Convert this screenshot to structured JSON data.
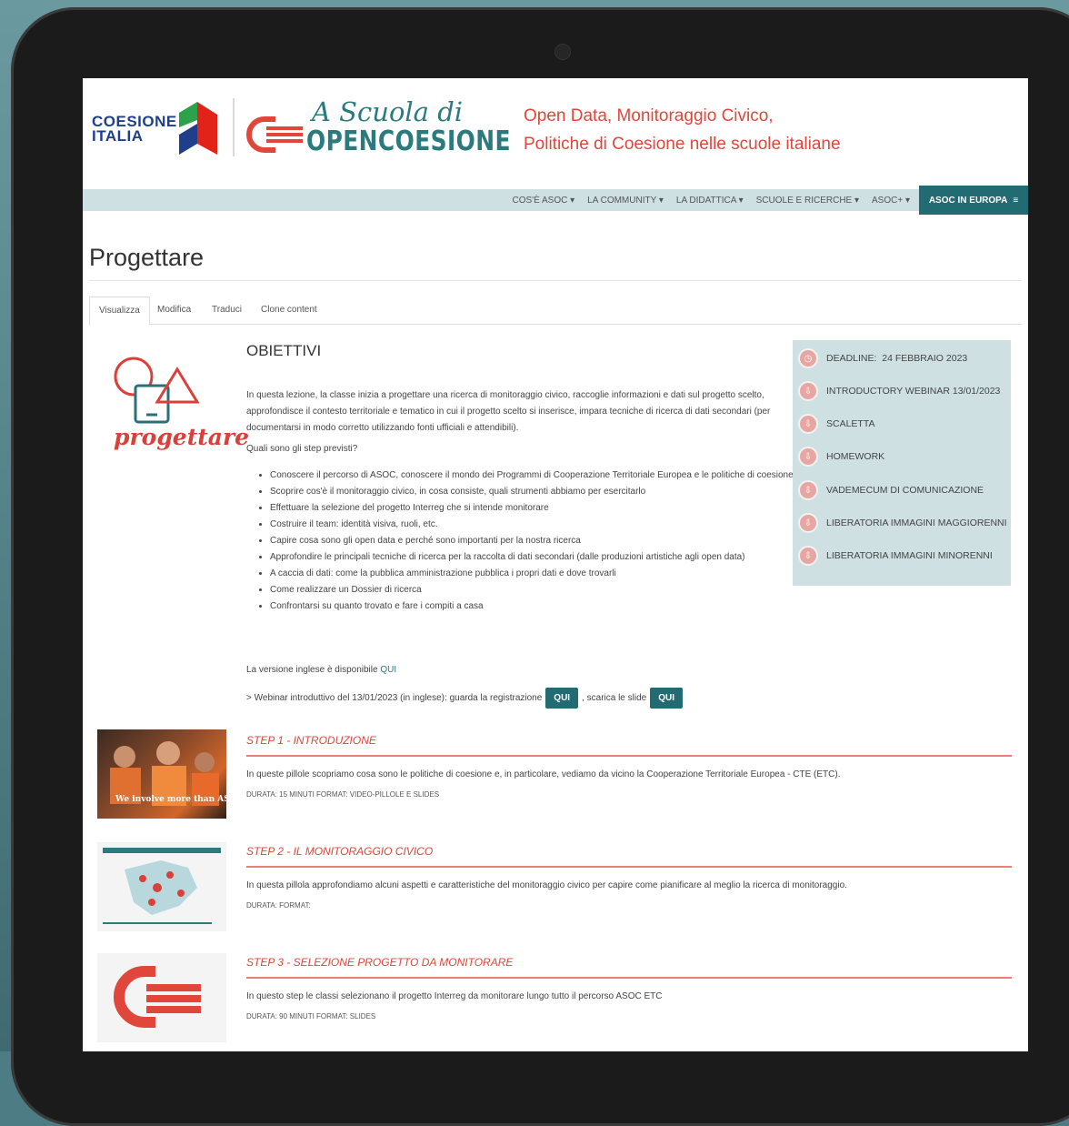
{
  "header": {
    "coesione_line1": "COESIONE",
    "coesione_line2": "ITALIA",
    "asoc_top": "A Scuola di",
    "asoc_bottom": "OPENCOESIONE",
    "tagline_line1": "Open Data, Monitoraggio Civico,",
    "tagline_line2": "Politiche di Coesione nelle scuole italiane"
  },
  "nav": {
    "items": [
      "COS'È ASOC ▾",
      "LA COMMUNITY ▾",
      "LA DIDATTICA ▾",
      "SCUOLE E RICERCHE ▾",
      "ASOC+ ▾"
    ],
    "europa": "ASOC IN EUROPA"
  },
  "page": {
    "title": "Progettare",
    "tabs": [
      "Visualizza",
      "Modifica",
      "Traduci",
      "Clone content"
    ]
  },
  "illustration_label": "progettare",
  "content": {
    "heading": "OBIETTIVI",
    "intro": "In questa lezione, la classe inizia a progettare una ricerca di monitoraggio civico, raccoglie informazioni e dati sul progetto scelto, approfondisce il contesto territoriale e tematico in cui il progetto scelto si inserisce, impara tecniche di ricerca di dati secondari (per documentarsi in modo corretto utilizzando fonti ufficiali e attendibili).",
    "steps_question": "Quali sono gli step previsti?",
    "steps": [
      "Conoscere il percorso di ASOC, conoscere il mondo dei Programmi di Cooperazione Territoriale Europea e le politiche di coesione",
      "Scoprire cos'è il monitoraggio civico, in cosa consiste, quali strumenti abbiamo per esercitarlo",
      "Effettuare la selezione del progetto Interreg che si intende monitorare",
      "Costruire il team: identità visiva, ruoli, etc.",
      "Capire cosa sono gli open data e perché sono importanti per la nostra ricerca",
      "Approfondire le principali tecniche di ricerca per la raccolta di dati secondari (dalle produzioni artistiche agli open data)",
      "A caccia di dati: come la pubblica amministrazione pubblica i propri dati e dove trovarli",
      "Come realizzare un Dossier di ricerca",
      "Confrontarsi su quanto trovato e fare i compiti a casa"
    ],
    "english_text": "La versione inglese è disponibile ",
    "english_link": "QUI",
    "webinar_text": "> Webinar introduttivo del 13/01/2023 (in inglese): guarda la registrazione",
    "webinar_btn1": "QUI",
    "webinar_mid": ", scarica le slide",
    "webinar_btn2": "QUI"
  },
  "sidebar": {
    "deadline_label": "DEADLINE:",
    "deadline_value": "24 FEBBRAIO 2023",
    "items": [
      "INTRODUCTORY WEBINAR 13/01/2023",
      "SCALETTA",
      "HOMEWORK",
      "VADEMECUM DI COMUNICAZIONE",
      "LIBERATORIA IMMAGINI MAGGIORENNI",
      "LIBERATORIA IMMAGINI MINORENNI"
    ]
  },
  "steps_sections": [
    {
      "title": "STEP 1 - INTRODUZIONE",
      "desc": "In queste pillole scopriamo cosa sono le politiche di coesione e, in particolare, vediamo da vicino la Cooperazione Territoriale Europea - CTE (ETC).",
      "meta": "DURATA: 15 MINUTI FORMAT: VIDEO-PILLOLE E SLIDES",
      "thumb_caption": "We involve more than ASO"
    },
    {
      "title": "STEP 2 - IL MONITORAGGIO CIVICO",
      "desc": "In questa pillola approfondiamo alcuni aspetti e caratteristiche del monitoraggio civico per capire come pianificare al meglio la ricerca di monitoraggio.",
      "meta": "DURATA: FORMAT:"
    },
    {
      "title": "STEP 3 - SELEZIONE PROGETTO DA MONITORARE",
      "desc": "In questo step le classi selezionano il progetto Interreg da monitorare lungo tutto il percorso ASOC ETC",
      "meta": "DURATA: 90 MINUTI FORMAT: SLIDES"
    }
  ],
  "colors": {
    "accent": "#226b73",
    "red": "#e0463a",
    "nav_bg": "#cfe0e3"
  }
}
